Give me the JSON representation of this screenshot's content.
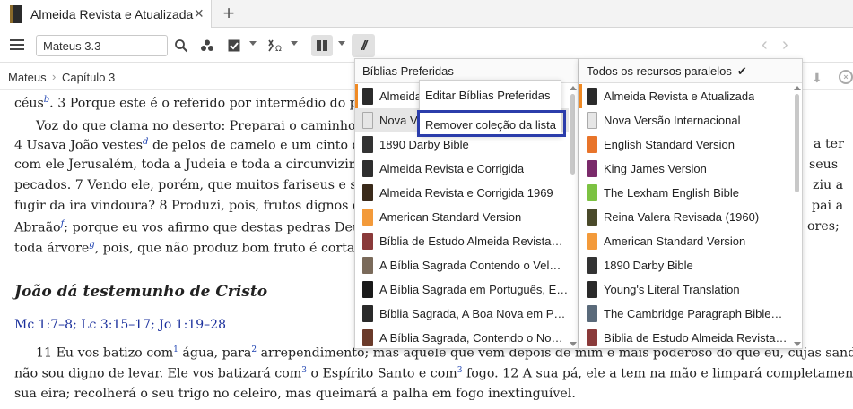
{
  "tab": {
    "title": "Almeida Revista e Atualizada",
    "close": "×",
    "add": "+"
  },
  "toolbar": {
    "reference": "Mateus 3.3",
    "icons": [
      "menu-icon",
      "search-icon",
      "visual-filter-icon",
      "checkbox-icon",
      "interlinear-icon",
      "layout-icon",
      "parallel-icon"
    ],
    "parallel_label": "//",
    "back": "‹",
    "forward": "›"
  },
  "breadcrumb": {
    "book": "Mateus",
    "sep": "›",
    "chapter": "Capítulo 3"
  },
  "content": {
    "l1a": "céus",
    "l1fn": "b",
    "l1b": ". 3 Porque este é o referido por intermédio do prof",
    "l2": "Voz do que clama no deserto: Preparai o caminho do",
    "l3a": "4 Usava João vestes",
    "l3fn": "d",
    "l3b": " de pelos de camelo e um cinto de c",
    "l3r": "a ter",
    "l4": "com ele Jerusalém, toda a Judeia e toda a circunvizinha",
    "l4r": "seus",
    "l5": "pecados. 7 Vendo ele, porém, que muitos fariseus e sa",
    "l5r": "ziu a",
    "l6": "fugir da ira vindoura? 8 Produzi, pois, frutos dignos de",
    "l6r": "pai a",
    "l7a": "Abraão",
    "l7fn": "f",
    "l7b": "; porque eu vos afirmo que destas pedras Deus",
    "l7r": "ores;",
    "l8a": "toda árvore",
    "l8fn": "g",
    "l8b": ", pois, que não produz bom fruto é cortada",
    "heading": "João dá testemunho de Cristo",
    "xrefs": "Mc 1:7–8; Lc 3:15–17; Jo 1:19–28",
    "v11a": "11 Eu vos batizo com",
    "v11c1": "1",
    "v11b": " água, para",
    "v11c2": "2",
    "v11c": " arrependimento; mas aquele que vem depois de mim é mais poderoso do que eu, cujas sandálias",
    "v11d": "não sou digno de levar. Ele vos batizará com",
    "v11c3": "3",
    "v11e": " o Espírito Santo e com",
    "v11c4": "3",
    "v11f": " fogo. 12 A sua pá, ele a tem na mão e limpará completamente a",
    "v12": "sua eira; recolherá o seu trigo no celeiro, mas queimará a palha em fogo inextinguível."
  },
  "preferred": {
    "header": "Bíblias Preferidas",
    "items": [
      {
        "label": "Almeida Revista e Atualizada",
        "color": "#2b2b2b"
      },
      {
        "label": "Nova Versão Internacional",
        "color": "#e6e6e6"
      },
      {
        "label": "1890 Darby Bible",
        "color": "#333333"
      },
      {
        "label": "Almeida Revista e Corrigida",
        "color": "#2e2e2e"
      },
      {
        "label": "Almeida Revista e Corrigida 1969",
        "color": "#3a2a1a"
      },
      {
        "label": "American Standard Version",
        "color": "#f39a3a"
      },
      {
        "label": "Bíblia de Estudo Almeida Revista…",
        "color": "#8a3a3a"
      },
      {
        "label": "A Bíblia Sagrada Contendo o Vel…",
        "color": "#7a6a5a"
      },
      {
        "label": "A Bíblia Sagrada em Português, E…",
        "color": "#1a1a1a"
      },
      {
        "label": "Bíblia Sagrada, A Boa Nova em P…",
        "color": "#2a2a2a"
      },
      {
        "label": "A Bíblia Sagrada, Contendo o No…",
        "color": "#6a3a2a"
      }
    ]
  },
  "context_menu": {
    "edit": "Editar Bíblias Preferidas",
    "remove": "Remover coleção da lista"
  },
  "parallel": {
    "header": "Todos os recursos paralelos",
    "check": "✔",
    "items": [
      {
        "label": "Almeida Revista e Atualizada",
        "color": "#2b2b2b"
      },
      {
        "label": "Nova Versão Internacional",
        "color": "#e6e6e6"
      },
      {
        "label": "English Standard Version",
        "color": "#e8742a"
      },
      {
        "label": "King James Version",
        "color": "#7a2a6a"
      },
      {
        "label": "The Lexham English Bible",
        "color": "#7cc242"
      },
      {
        "label": "Reina Valera Revisada (1960)",
        "color": "#4a4a2a"
      },
      {
        "label": "American Standard Version",
        "color": "#f39a3a"
      },
      {
        "label": "1890 Darby Bible",
        "color": "#333333"
      },
      {
        "label": "Young's Literal Translation",
        "color": "#2a2a2a"
      },
      {
        "label": "The Cambridge Paragraph Bible…",
        "color": "#5a6a7a"
      },
      {
        "label": "Bíblia de Estudo Almeida Revista…",
        "color": "#8a3a3a"
      }
    ]
  }
}
